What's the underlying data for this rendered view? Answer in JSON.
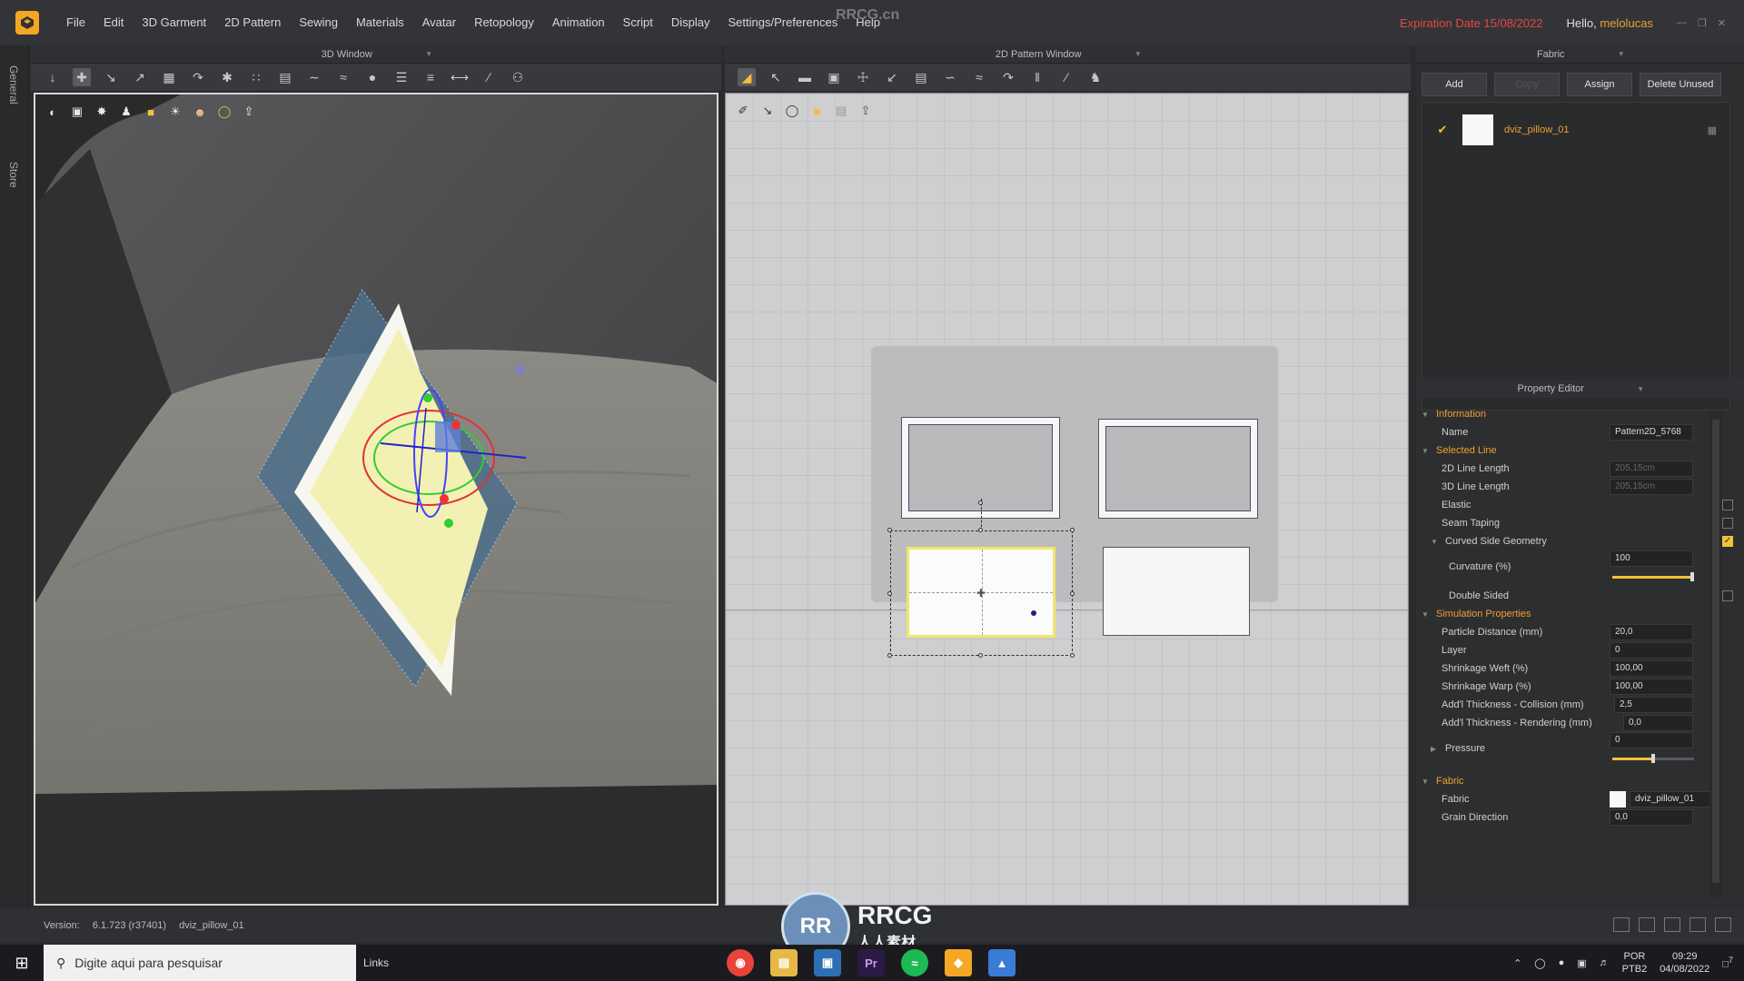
{
  "watermark": "RRCG.cn",
  "menu": [
    "File",
    "Edit",
    "3D Garment",
    "2D Pattern",
    "Sewing",
    "Materials",
    "Avatar",
    "Retopology",
    "Animation",
    "Script",
    "Display",
    "Settings/Preferences",
    "Help"
  ],
  "header": {
    "expiration": "Expiration Date 15/08/2022",
    "hello": "Hello,",
    "user": "melolucas"
  },
  "vtabs": {
    "general": "General",
    "store": "Store"
  },
  "window3d": {
    "title": "3D Window"
  },
  "window2d": {
    "title": "2D Pattern Window"
  },
  "fabric_panel": {
    "title": "Fabric",
    "buttons": {
      "add": "Add",
      "copy": "Copy",
      "assign": "Assign",
      "delete_unused": "Delete Unused"
    },
    "items": [
      {
        "name": "dviz_pillow_01",
        "checked": true
      }
    ]
  },
  "property_editor": {
    "title": "Property Editor",
    "information": {
      "label": "Information",
      "name_label": "Name",
      "name_value": "Pattern2D_5768"
    },
    "selected_line": {
      "label": "Selected Line",
      "line2d_label": "2D Line Length",
      "line2d_value": "205,15cm",
      "line3d_label": "3D Line Length",
      "line3d_value": "205,15cm",
      "elastic_label": "Elastic",
      "seam_taping_label": "Seam Taping",
      "curved_label": "Curved Side Geometry",
      "curvature_label": "Curvature (%)",
      "curvature_value": "100",
      "curvature_fraction": 1.0,
      "double_sided_label": "Double Sided"
    },
    "simulation": {
      "label": "Simulation Properties",
      "particle_label": "Particle Distance (mm)",
      "particle_value": "20,0",
      "layer_label": "Layer",
      "layer_value": "0",
      "weft_label": "Shrinkage Weft (%)",
      "weft_value": "100,00",
      "warp_label": "Shrinkage Warp (%)",
      "warp_value": "100,00",
      "collision_label": "Add'l Thickness - Collision (mm)",
      "collision_value": "2,5",
      "rendering_label": "Add'l Thickness - Rendering (mm)",
      "rendering_value": "0,0",
      "pressure_label": "Pressure",
      "pressure_value": "0",
      "pressure_fraction": 0.5
    },
    "fabric": {
      "label": "Fabric",
      "fabric_label": "Fabric",
      "fabric_value": "dviz_pillow_01",
      "grain_label": "Grain Direction",
      "grain_value": "0,0"
    }
  },
  "status": {
    "version_label": "Version:",
    "version": "6.1.723 (r37401)",
    "file": "dviz_pillow_01"
  },
  "taskbar": {
    "search_placeholder": "Digite aqui para pesquisar",
    "links": "Links",
    "lang": "POR",
    "layout": "PTB2",
    "time": "09:29",
    "date": "04/08/2022",
    "notif": "7"
  },
  "wm_logo": {
    "badge": "RR",
    "line1": "RRCG",
    "line2": "人人素材"
  },
  "colors": {
    "accent": "#f0a030",
    "expiry": "#e8463f",
    "selection": "#f3e56a"
  }
}
